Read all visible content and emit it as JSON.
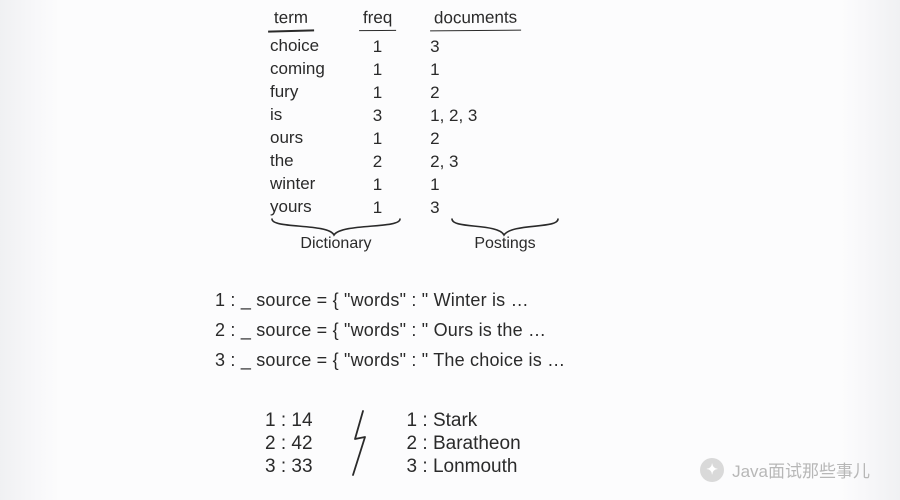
{
  "table": {
    "headers": {
      "term": "term",
      "freq": "freq",
      "documents": "documents"
    },
    "rows": [
      {
        "term": "choice",
        "freq": "1",
        "documents": "3"
      },
      {
        "term": "coming",
        "freq": "1",
        "documents": "1"
      },
      {
        "term": "fury",
        "freq": "1",
        "documents": "2"
      },
      {
        "term": "is",
        "freq": "3",
        "documents": "1, 2, 3"
      },
      {
        "term": "ours",
        "freq": "1",
        "documents": "2"
      },
      {
        "term": "the",
        "freq": "2",
        "documents": "2, 3"
      },
      {
        "term": "winter",
        "freq": "1",
        "documents": "1"
      },
      {
        "term": "yours",
        "freq": "1",
        "documents": "3"
      }
    ],
    "brace_labels": {
      "dictionary": "Dictionary",
      "postings": "Postings"
    }
  },
  "sources": [
    "1 :  _ source = { \"words\" :  \" Winter is …",
    "2 :  _ source = { \"words\" :  \" Ours  is the …",
    "3 :  _ source = { \"words\" :  \" The choice is …"
  ],
  "bottom": {
    "left": [
      "1 :  14",
      "2 :  42",
      "3 :  33"
    ],
    "right": [
      "1 :  Stark",
      "2 :  Baratheon",
      "3 :  Lonmouth"
    ]
  },
  "watermark": "Java面试那些事儿"
}
